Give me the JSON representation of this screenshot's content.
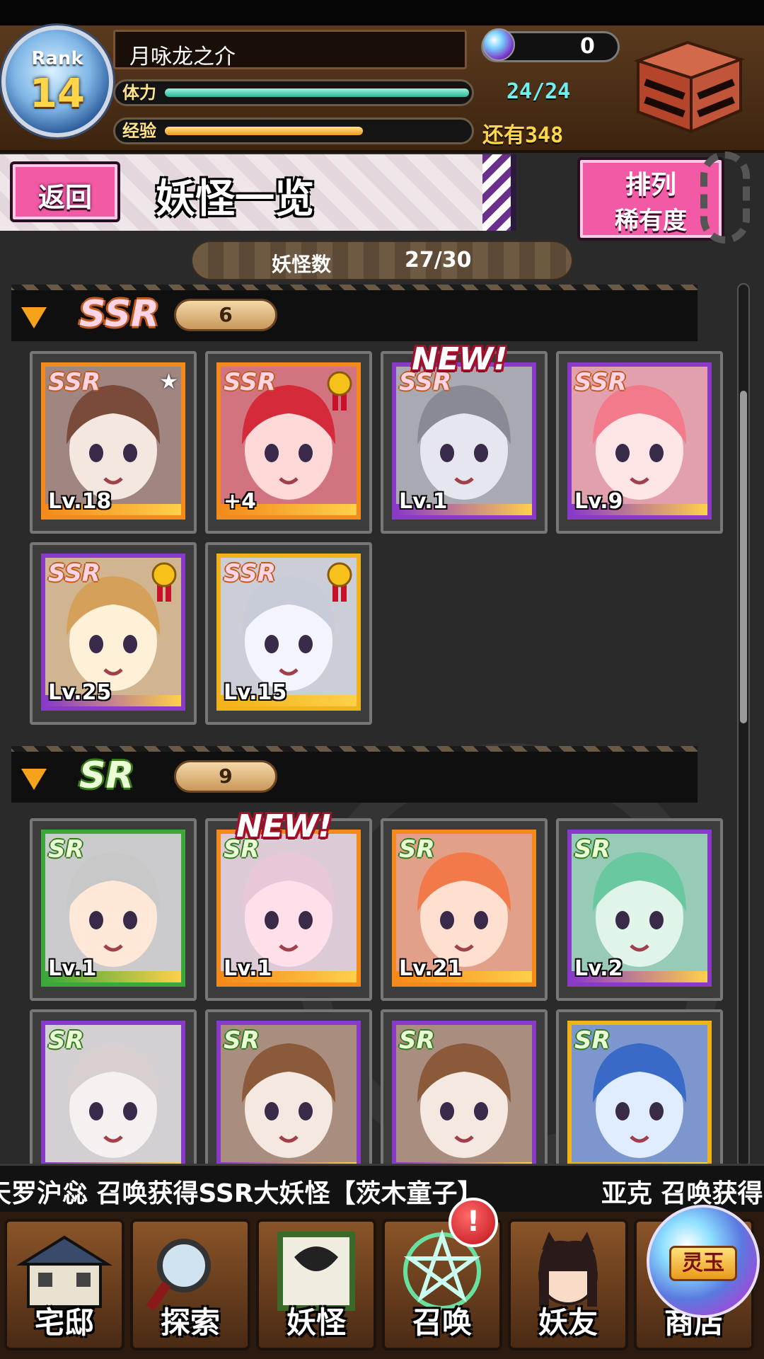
{
  "player": {
    "rank_label": "Rank",
    "rank": "14",
    "name": "月咏龙之介",
    "gems": "0",
    "stamina_label": "体力",
    "stamina_value": "24/24",
    "stamina_fraction": 1.0,
    "exp_label": "经验",
    "exp_value": "还有348",
    "exp_fraction": 0.65
  },
  "header": {
    "back_label": "返回",
    "title": "妖怪一览",
    "sort_line1": "排列",
    "sort_line2": "稀有度"
  },
  "count": {
    "label": "妖怪数",
    "value": "27/30"
  },
  "sections": {
    "ssr": {
      "rarity": "SSR",
      "count": "6"
    },
    "sr": {
      "rarity": "SR",
      "count": "9"
    }
  },
  "cards": {
    "ssr": [
      {
        "rarity": "SSR",
        "level": "Lv.18",
        "frame": "orange",
        "badge": "star"
      },
      {
        "rarity": "SSR",
        "level": "+4",
        "frame": "orange",
        "badge": "medal"
      },
      {
        "rarity": "SSR",
        "level": "Lv.1",
        "frame": "purple",
        "badge": "new"
      },
      {
        "rarity": "SSR",
        "level": "Lv.9",
        "frame": "purple",
        "badge": ""
      },
      {
        "rarity": "SSR",
        "level": "Lv.25",
        "frame": "purple",
        "badge": "medal"
      },
      {
        "rarity": "SSR",
        "level": "Lv.15",
        "frame": "gold",
        "badge": "medal"
      }
    ],
    "sr": [
      {
        "rarity": "SR",
        "level": "Lv.1",
        "frame": "green",
        "badge": ""
      },
      {
        "rarity": "SR",
        "level": "Lv.1",
        "frame": "orange",
        "badge": "new"
      },
      {
        "rarity": "SR",
        "level": "Lv.21",
        "frame": "orange",
        "badge": ""
      },
      {
        "rarity": "SR",
        "level": "Lv.2",
        "frame": "purple",
        "badge": ""
      },
      {
        "rarity": "SR",
        "level": "",
        "frame": "purple",
        "badge": ""
      },
      {
        "rarity": "SR",
        "level": "",
        "frame": "purple",
        "badge": ""
      },
      {
        "rarity": "SR",
        "level": "",
        "frame": "purple",
        "badge": ""
      },
      {
        "rarity": "SR",
        "level": "",
        "frame": "gold",
        "badge": ""
      }
    ],
    "new_label": "NEW!"
  },
  "ticker": {
    "msg1": "天罗沪惢 召唤获得SSR大妖怪【茨木童子】",
    "msg2": "亚克 召唤获得"
  },
  "nav": {
    "home": "宅邸",
    "explore": "探索",
    "yokai": "妖怪",
    "summon": "召唤",
    "friends": "妖友",
    "shop": "商店",
    "shop_tag": "灵玉",
    "alert": "!"
  },
  "colors": {
    "ssr_outline": "#c45a1a",
    "sr_outline": "#2f7a1a",
    "orange_frame": "#f48a1a",
    "purple_frame": "#8a3ac8",
    "green_frame": "#3aa83a",
    "gold_frame": "#f2b21a",
    "pink_button": "#f25aa5"
  }
}
